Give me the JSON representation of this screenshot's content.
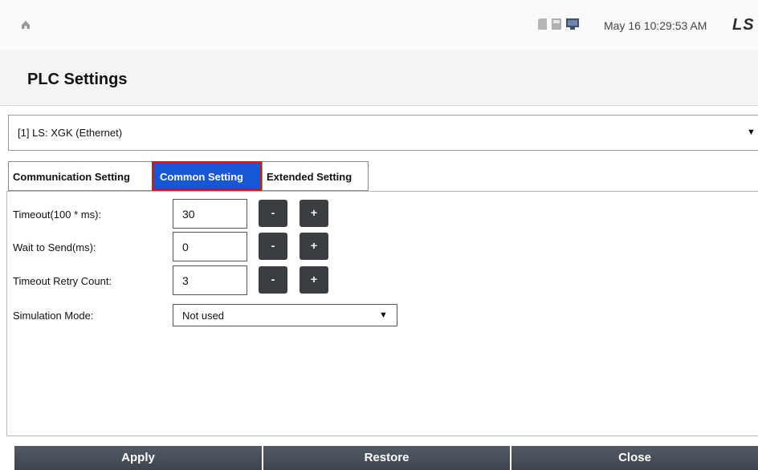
{
  "header": {
    "home_icon": "home-icon",
    "status_icons": [
      "sd-card-icon",
      "usb-icon",
      "monitor-icon"
    ],
    "datetime": "May 16 10:29:53 AM",
    "brand": "LS"
  },
  "page": {
    "title": "PLC Settings"
  },
  "device_select": {
    "value": "[1] LS: XGK (Ethernet)"
  },
  "tabs": [
    {
      "label": "Communication Setting",
      "active": false
    },
    {
      "label": "Common Setting",
      "active": true
    },
    {
      "label": "Extended Setting",
      "active": false
    }
  ],
  "settings": {
    "timeout": {
      "label": "Timeout(100 * ms):",
      "value": "30"
    },
    "wait_to_send": {
      "label": "Wait to Send(ms):",
      "value": "0"
    },
    "retry_count": {
      "label": "Timeout Retry Count:",
      "value": "3"
    },
    "simulation_mode": {
      "label": "Simulation Mode:",
      "value": "Not used"
    },
    "minus_label": "-",
    "plus_label": "+"
  },
  "footer": {
    "apply": "Apply",
    "restore": "Restore",
    "close": "Close"
  },
  "colors": {
    "active_tab": "#1757d6",
    "highlight_border": "#e0101e",
    "button_dark": "#3e444d"
  }
}
